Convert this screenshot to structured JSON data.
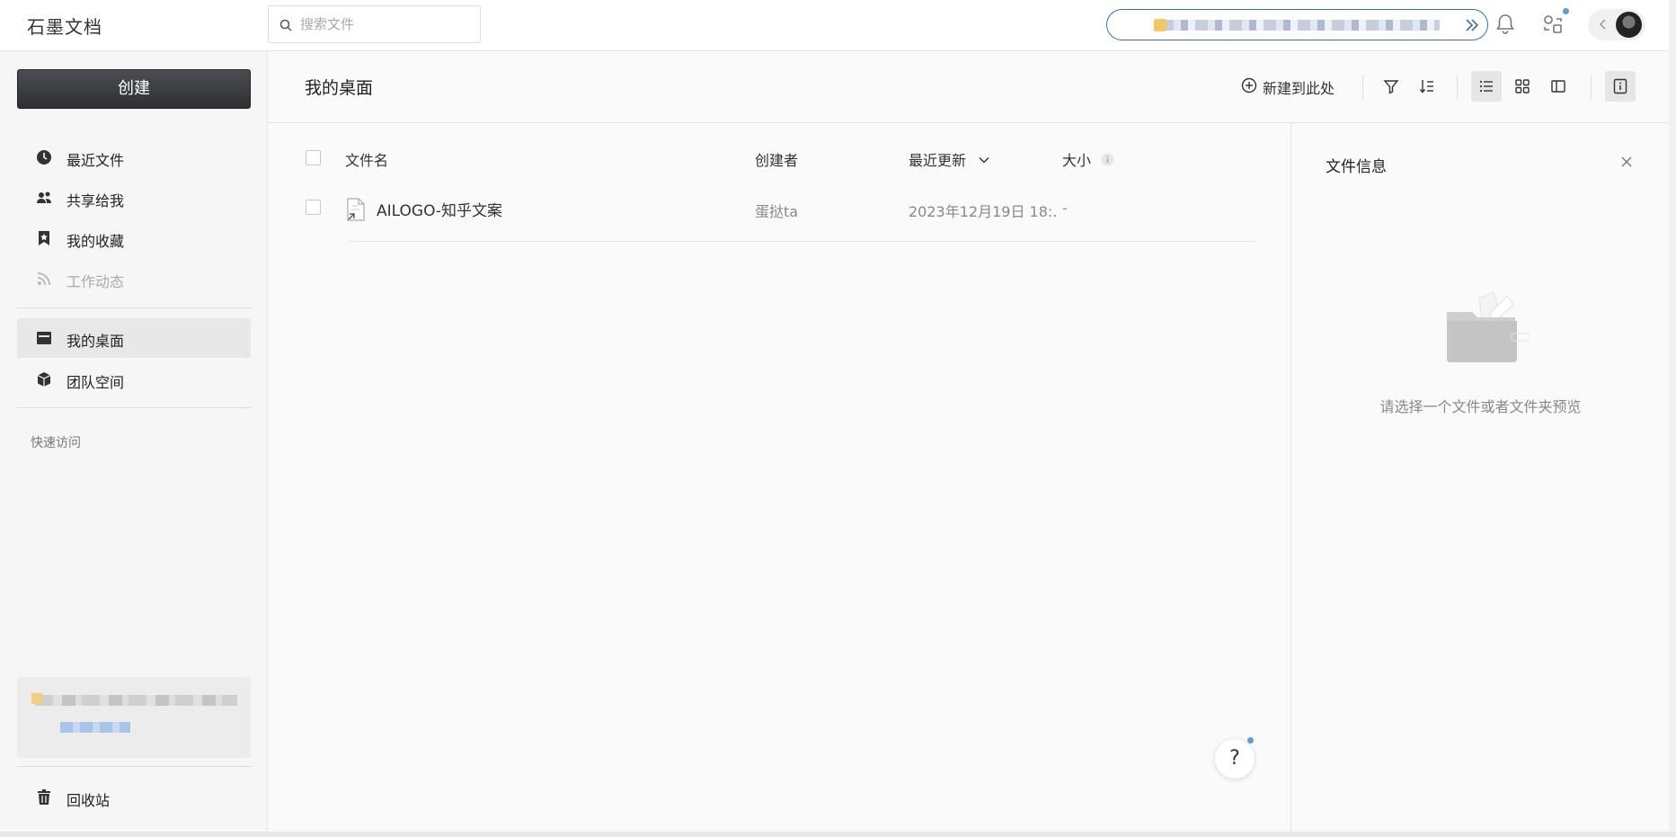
{
  "app": {
    "title": "石墨文档"
  },
  "search": {
    "placeholder": "搜索文件"
  },
  "sidebar": {
    "create_label": "创建",
    "items": [
      {
        "label": "最近文件",
        "icon": "clock-icon"
      },
      {
        "label": "共享给我",
        "icon": "users-icon"
      },
      {
        "label": "我的收藏",
        "icon": "bookmark-icon"
      },
      {
        "label": "工作动态",
        "icon": "rss-icon",
        "disabled": true
      },
      {
        "label": "我的桌面",
        "icon": "desktop-icon",
        "active": true
      },
      {
        "label": "团队空间",
        "icon": "cube-icon"
      }
    ],
    "quick_access_label": "快速访问",
    "trash_label": "回收站"
  },
  "main": {
    "title": "我的桌面",
    "new_here_label": "新建到此处",
    "columns": {
      "name": "文件名",
      "creator": "创建者",
      "updated": "最近更新",
      "size": "大小"
    },
    "rows": [
      {
        "name": "AILOGO-知乎文案",
        "creator": "蛋挞ta",
        "updated": "2023年12月19日 18:…",
        "size": "-"
      }
    ]
  },
  "info_panel": {
    "title": "文件信息",
    "empty_text": "请选择一个文件或者文件夹预览"
  },
  "help": {
    "label": "?"
  },
  "colors": {
    "accent": "#3a6fb0",
    "notification_dot": "#5b9be0",
    "create_button": "#36383c"
  }
}
